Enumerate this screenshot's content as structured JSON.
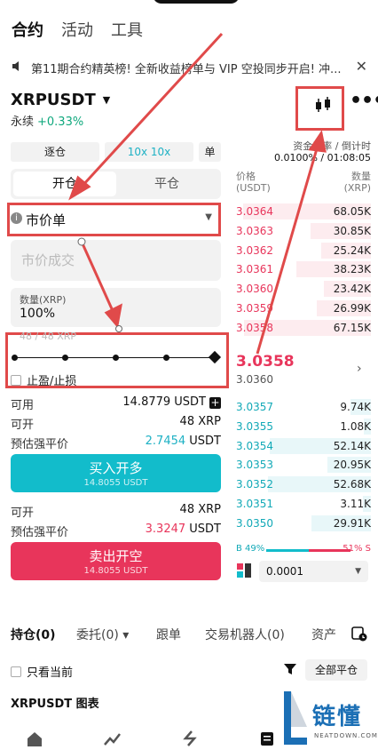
{
  "top_tabs": [
    "合约",
    "活动",
    "工具"
  ],
  "announcement": {
    "text": "第11期合约精英榜! 全新收益榜单与 VIP 空投同步开启! 冲...",
    "close_glyph": "✕"
  },
  "ticker": {
    "symbol": "XRPUSDT",
    "caret": "▼",
    "type": "永续",
    "change": "+0.33%"
  },
  "more_glyph": "•••",
  "margin_mode": {
    "isolated": "逐仓",
    "leverage": "10x 10x",
    "single": "单"
  },
  "open_close": {
    "open": "开仓",
    "close": "平仓",
    "active": "open"
  },
  "order_type": {
    "info": "i",
    "label": "市价单",
    "caret": "▼"
  },
  "price_input": {
    "placeholder": "市价成交"
  },
  "quantity": {
    "label": "数量(XRP)",
    "value": "100%"
  },
  "slider": {
    "range_text": "48 / 48 XRP",
    "value_fraction": 1.0
  },
  "tpsl_label": "止盈/止损",
  "buy_panel": {
    "available_label": "可用",
    "available_value": "14.8779 USDT",
    "openable_label": "可开",
    "openable_value": "48 XRP",
    "liq_label": "预估强平价",
    "liq_value": "2.7454",
    "liq_unit": "USDT",
    "button_label": "买入开多",
    "button_sub": "14.8055 USDT"
  },
  "sell_panel": {
    "openable_label": "可开",
    "openable_value": "48 XRP",
    "liq_label": "预估强平价",
    "liq_value": "3.3247",
    "liq_unit": "USDT",
    "button_label": "卖出开空",
    "button_sub": "14.8055 USDT"
  },
  "orderbook": {
    "funding_label": "资金费率 / 倒计时",
    "funding_value": "0.0100% / 01:08:05",
    "price_header": "价格",
    "price_unit": "(USDT)",
    "qty_header": "数量",
    "qty_unit": "(XRP)",
    "asks": [
      {
        "price": "3.0364",
        "qty": "68.05K",
        "depth": 0.95
      },
      {
        "price": "3.0363",
        "qty": "30.85K",
        "depth": 0.45
      },
      {
        "price": "3.0362",
        "qty": "25.24K",
        "depth": 0.37
      },
      {
        "price": "3.0361",
        "qty": "38.23K",
        "depth": 0.55
      },
      {
        "price": "3.0360",
        "qty": "23.42K",
        "depth": 0.35
      },
      {
        "price": "3.0359",
        "qty": "26.99K",
        "depth": 0.4
      },
      {
        "price": "3.0358",
        "qty": "67.15K",
        "depth": 0.94
      }
    ],
    "last_price": "3.0358",
    "mark_price": "3.0360",
    "arrow": "›",
    "bids": [
      {
        "price": "3.0357",
        "qty": "9.74K",
        "depth": 0.15
      },
      {
        "price": "3.0355",
        "qty": "1.08K",
        "depth": 0.05
      },
      {
        "price": "3.0354",
        "qty": "52.14K",
        "depth": 0.75
      },
      {
        "price": "3.0353",
        "qty": "20.95K",
        "depth": 0.32
      },
      {
        "price": "3.0352",
        "qty": "52.68K",
        "depth": 0.76
      },
      {
        "price": "3.0351",
        "qty": "3.11K",
        "depth": 0.06
      },
      {
        "price": "3.0350",
        "qty": "29.91K",
        "depth": 0.44
      }
    ],
    "buy_ratio": "B 49%",
    "sell_ratio": "51% S",
    "tick_size": "0.0001"
  },
  "position_tabs": [
    "持仓(0)",
    "委托(0) ▾",
    "跟单",
    "交易机器人(0)",
    "资产"
  ],
  "only_current": "只看当前",
  "close_all": "全部平仓",
  "chart_label": "XRPUSDT 图表",
  "watermark": {
    "cn": "链懂",
    "en": "NEATDOWN.COM"
  },
  "colors": {
    "buy": "#12bccb",
    "sell": "#e8355b",
    "annotation": "#e04a4a"
  }
}
